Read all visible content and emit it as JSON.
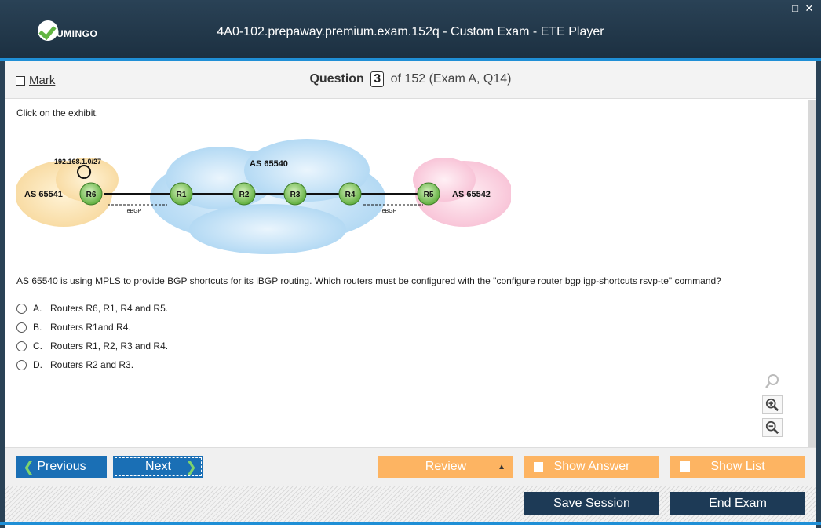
{
  "titlebar": {
    "logo_text": "UMINGO",
    "title": "4A0-102.prepaway.premium.exam.152q - Custom Exam - ETE Player",
    "window_controls": [
      "minimize-icon",
      "maximize-icon",
      "close-icon"
    ]
  },
  "question_bar": {
    "mark_label": "Mark",
    "question_label": "Question",
    "question_number": "3",
    "question_of": "of 152 (Exam A, Q14)"
  },
  "content": {
    "prompt": "Click on the exhibit.",
    "exhibit": {
      "left_as": "AS 65541",
      "center_as": "AS 65540",
      "right_as": "AS 65542",
      "prefix": "192.168.1.0/27",
      "routers": [
        "R6",
        "R1",
        "R2",
        "R3",
        "R4",
        "R5"
      ],
      "link_label_left": "eBGP",
      "link_label_right": "eBGP"
    },
    "question_text": "AS 65540 is using MPLS to provide BGP shortcuts for its iBGP routing. Which routers must be configured with the \"configure router bgp igp-shortcuts rsvp-te\" command?",
    "options": [
      {
        "letter": "A.",
        "text": "Routers R6, R1, R4 and R5."
      },
      {
        "letter": "B.",
        "text": "Routers R1and R4."
      },
      {
        "letter": "C.",
        "text": "Routers R1, R2, R3 and R4."
      },
      {
        "letter": "D.",
        "text": "Routers R2 and R3."
      }
    ],
    "zoom_icons": [
      "zoom-icon",
      "zoom-in-icon",
      "zoom-out-icon"
    ]
  },
  "nav": {
    "previous": "Previous",
    "next": "Next",
    "review": "Review",
    "show_answer": "Show Answer",
    "show_list": "Show List",
    "save_session": "Save Session",
    "end_exam": "End Exam"
  },
  "colors": {
    "titlebar": "#1c3041",
    "accent_blue": "#1f8fd6",
    "nav_blue": "#1a6fb5",
    "orange": "#fdb462",
    "dark_button": "#1d3a56"
  }
}
